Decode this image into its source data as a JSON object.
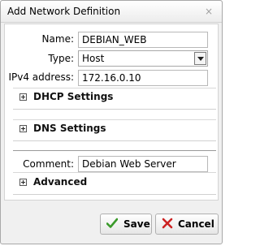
{
  "dialog": {
    "title": "Add Network Definition",
    "close_glyph": "×"
  },
  "form": {
    "name": {
      "label": "Name:",
      "value": "DEBIAN_WEB"
    },
    "type": {
      "label": "Type:",
      "value": "Host"
    },
    "ipv4": {
      "label": "IPv4 address:",
      "value": "172.16.0.10"
    },
    "comment": {
      "label": "Comment:",
      "value": "Debian Web Server"
    }
  },
  "sections": {
    "dhcp": "DHCP Settings",
    "dns": "DNS Settings",
    "advanced": "Advanced"
  },
  "buttons": {
    "save": "Save",
    "cancel": "Cancel"
  },
  "colors": {
    "save_icon": "#3a9a2a",
    "cancel_icon": "#cc2222"
  },
  "icons": {
    "expand": "plus-box-icon",
    "save": "checkmark-icon",
    "cancel": "x-icon"
  }
}
